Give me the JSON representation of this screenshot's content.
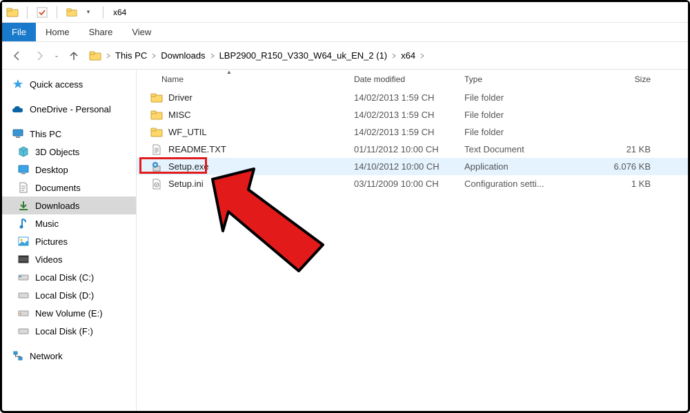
{
  "window": {
    "title": "x64"
  },
  "ribbon": {
    "file": "File",
    "tabs": [
      "Home",
      "Share",
      "View"
    ]
  },
  "breadcrumb": [
    "This PC",
    "Downloads",
    "LBP2900_R150_V330_W64_uk_EN_2 (1)",
    "x64"
  ],
  "columns": {
    "name": "Name",
    "date": "Date modified",
    "type": "Type",
    "size": "Size"
  },
  "sidebar": {
    "quick": "Quick access",
    "onedrive": "OneDrive - Personal",
    "thispc": "This PC",
    "items": [
      "3D Objects",
      "Desktop",
      "Documents",
      "Downloads",
      "Music",
      "Pictures",
      "Videos",
      "Local Disk (C:)",
      "Local Disk (D:)",
      "New Volume (E:)",
      "Local Disk (F:)"
    ],
    "network": "Network"
  },
  "rows": [
    {
      "name": "Driver",
      "date": "14/02/2013 1:59 CH",
      "type": "File folder",
      "size": ""
    },
    {
      "name": "MISC",
      "date": "14/02/2013 1:59 CH",
      "type": "File folder",
      "size": ""
    },
    {
      "name": "WF_UTIL",
      "date": "14/02/2013 1:59 CH",
      "type": "File folder",
      "size": ""
    },
    {
      "name": "README.TXT",
      "date": "01/11/2012 10:00 CH",
      "type": "Text Document",
      "size": "21 KB"
    },
    {
      "name": "Setup.exe",
      "date": "14/10/2012 10:00 CH",
      "type": "Application",
      "size": "6.076 KB"
    },
    {
      "name": "Setup.ini",
      "date": "03/11/2009 10:00 CH",
      "type": "Configuration setti...",
      "size": "1 KB"
    }
  ]
}
